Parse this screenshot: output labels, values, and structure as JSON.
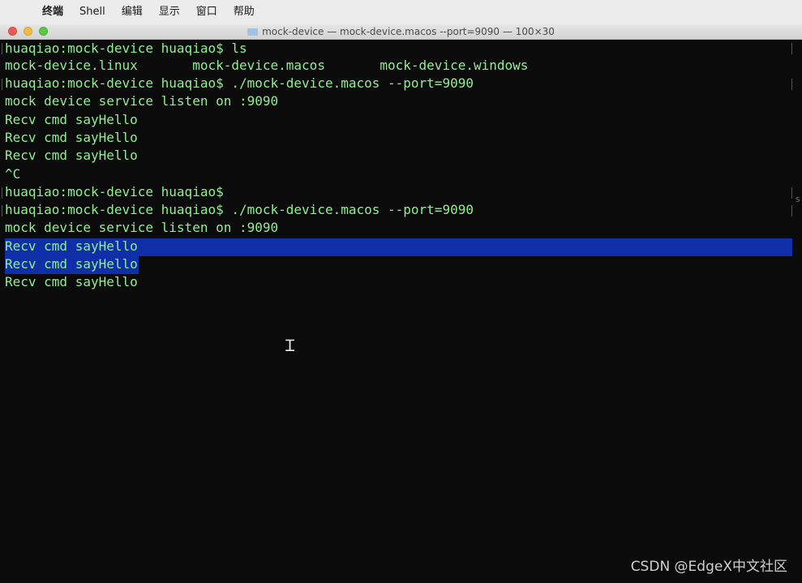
{
  "menubar": {
    "apple_icon": "apple-icon",
    "items": [
      "终端",
      "Shell",
      "编辑",
      "显示",
      "窗口",
      "帮助"
    ]
  },
  "window": {
    "title": "mock-device — mock-device.macos --port=9090 — 100×30",
    "colors": {
      "background": "#0b0b0b",
      "text": "#8ff08f",
      "selection": "#0f2ea8"
    }
  },
  "terminal": {
    "lines": [
      "huaqiao:mock-device huaqiao$ ls",
      "mock-device.linux       mock-device.macos       mock-device.windows",
      "huaqiao:mock-device huaqiao$ ./mock-device.macos --port=9090",
      "mock device service listen on :9090",
      "Recv cmd sayHello",
      "Recv cmd sayHello",
      "Recv cmd sayHello",
      "^C",
      "huaqiao:mock-device huaqiao$",
      "huaqiao:mock-device huaqiao$ ./mock-device.macos --port=9090",
      "mock device service listen on :9090",
      "Recv cmd sayHello",
      "Recv cmd sayHello",
      "Recv cmd sayHello"
    ],
    "right_edge_char": "s"
  },
  "watermark": "CSDN @EdgeX中文社区"
}
